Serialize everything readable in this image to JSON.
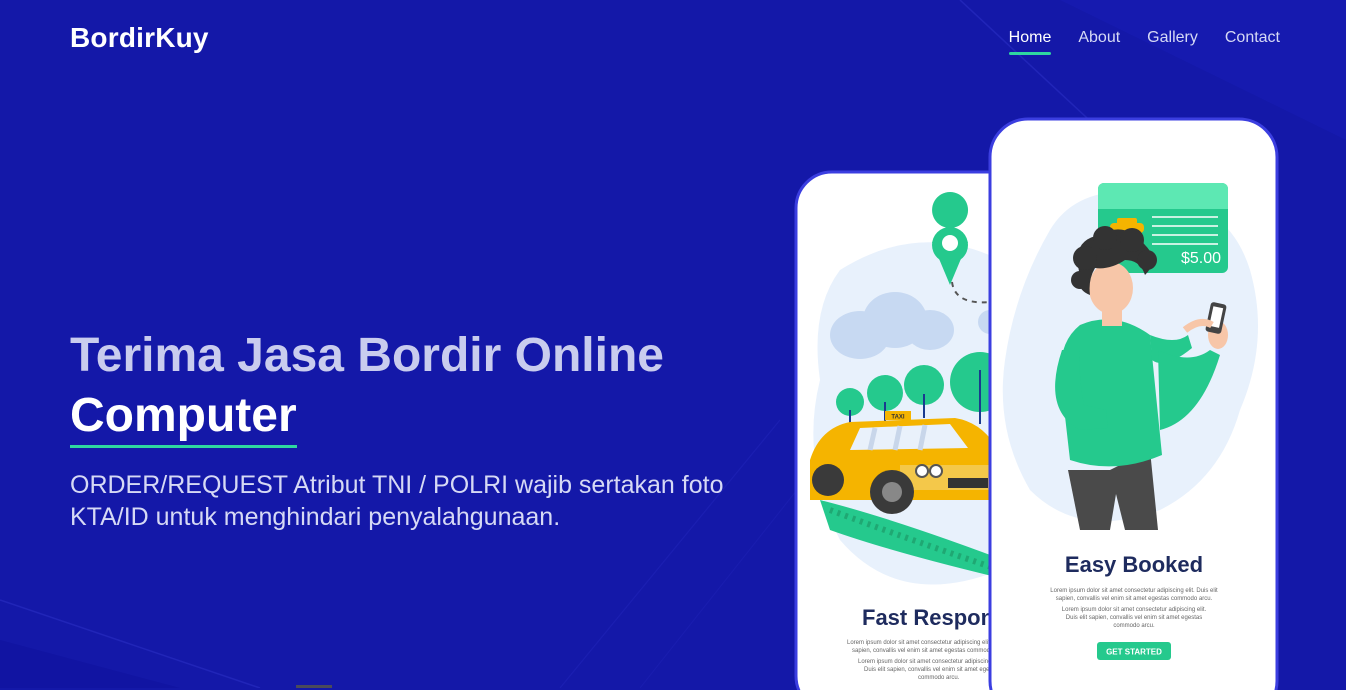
{
  "brand": "BordirKuy",
  "nav": {
    "items": [
      "Home",
      "About",
      "Gallery",
      "Contact"
    ],
    "active": "Home"
  },
  "hero": {
    "title_line1": "Terima Jasa Bordir Online",
    "title_line2": "Computer",
    "subtitle": "ORDER/REQUEST Atribut TNI / POLRI wajib sertakan foto KTA/ID untuk menghindari penyalahgunaan."
  },
  "illustration": {
    "left_phone_heading": "Fast Respon",
    "right_phone_heading": "Easy Booked",
    "price": "$5.00",
    "taxi_sign": "TAXI",
    "cta": "GET STARTED",
    "lorem_1": "Lorem ipsum dolor sit amet consectetur adipiscing elit. Duis elit",
    "lorem_2": "sapien, convallis vel enim sit amet egestas commodo arcu.",
    "lorem_3": "Lorem ipsum dolor sit amet consectetur adipiscing elit.",
    "lorem_4": "Duis elit sapien, convallis vel enim sit amet egestas",
    "lorem_5": "commodo arcu."
  },
  "colors": {
    "background": "#1418a8",
    "accent": "#2fd7a0",
    "phone_border": "#3b3ee0"
  }
}
